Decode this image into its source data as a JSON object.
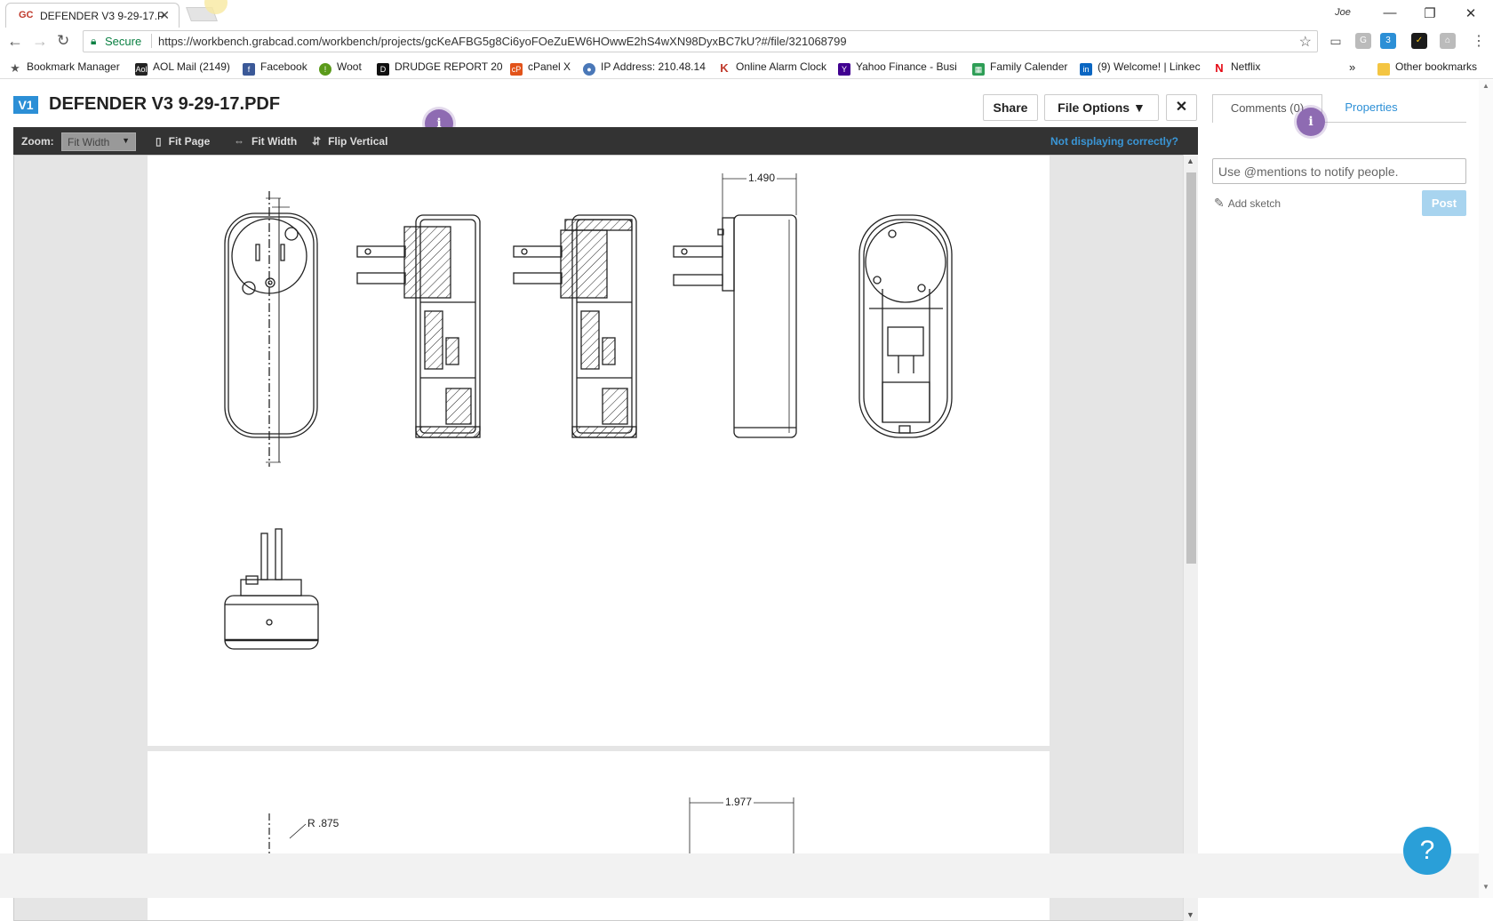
{
  "browser": {
    "tab_title": "DEFENDER V3 9-29-17.PI",
    "tab_favicon": "GC",
    "user": "Joe",
    "secure_label": "Secure",
    "url": "https://workbench.grabcad.com/workbench/projects/gcKeAFBG5g8Ci6yoFOeZuEW6HOwwE2hS4wXN98DyxBC7kU?#/file/321068799",
    "ext_badge": "3",
    "bookmarks": [
      "Bookmark Manager",
      "AOL Mail (2149)",
      "Facebook",
      "Woot",
      "DRUDGE REPORT 20",
      "cPanel X",
      "IP Address: 210.48.14",
      "Online Alarm Clock",
      "Yahoo Finance - Busi",
      "Family Calender",
      "(9) Welcome! | Linkec",
      "Netflix"
    ],
    "other_bookmarks": "Other bookmarks"
  },
  "app": {
    "version_badge": "V1",
    "doc_title": "DEFENDER V3 9-29-17.PDF",
    "share_label": "Share",
    "file_options_label": "File Options",
    "info_glyph": "i",
    "toolbar": {
      "zoom_label": "Zoom:",
      "zoom_value": "Fit Width",
      "fit_page": "Fit Page",
      "fit_width": "Fit Width",
      "flip_vertical": "Flip Vertical",
      "not_displaying": "Not displaying correctly?"
    },
    "drawing": {
      "dim_top": "1.490",
      "dim_page2": "1.977",
      "radius_page2": "R .875"
    },
    "panel": {
      "comments_tab": "Comments (0)",
      "properties_tab": "Properties",
      "mention_placeholder": "Use @mentions to notify people.",
      "add_sketch": "Add sketch",
      "post_label": "Post"
    },
    "help_glyph": "?"
  },
  "colors": {
    "accent": "#2c8fd6",
    "toolbar": "#333333",
    "info_dot": "#8e6bb2",
    "post_disabled": "#a8d4ef"
  }
}
